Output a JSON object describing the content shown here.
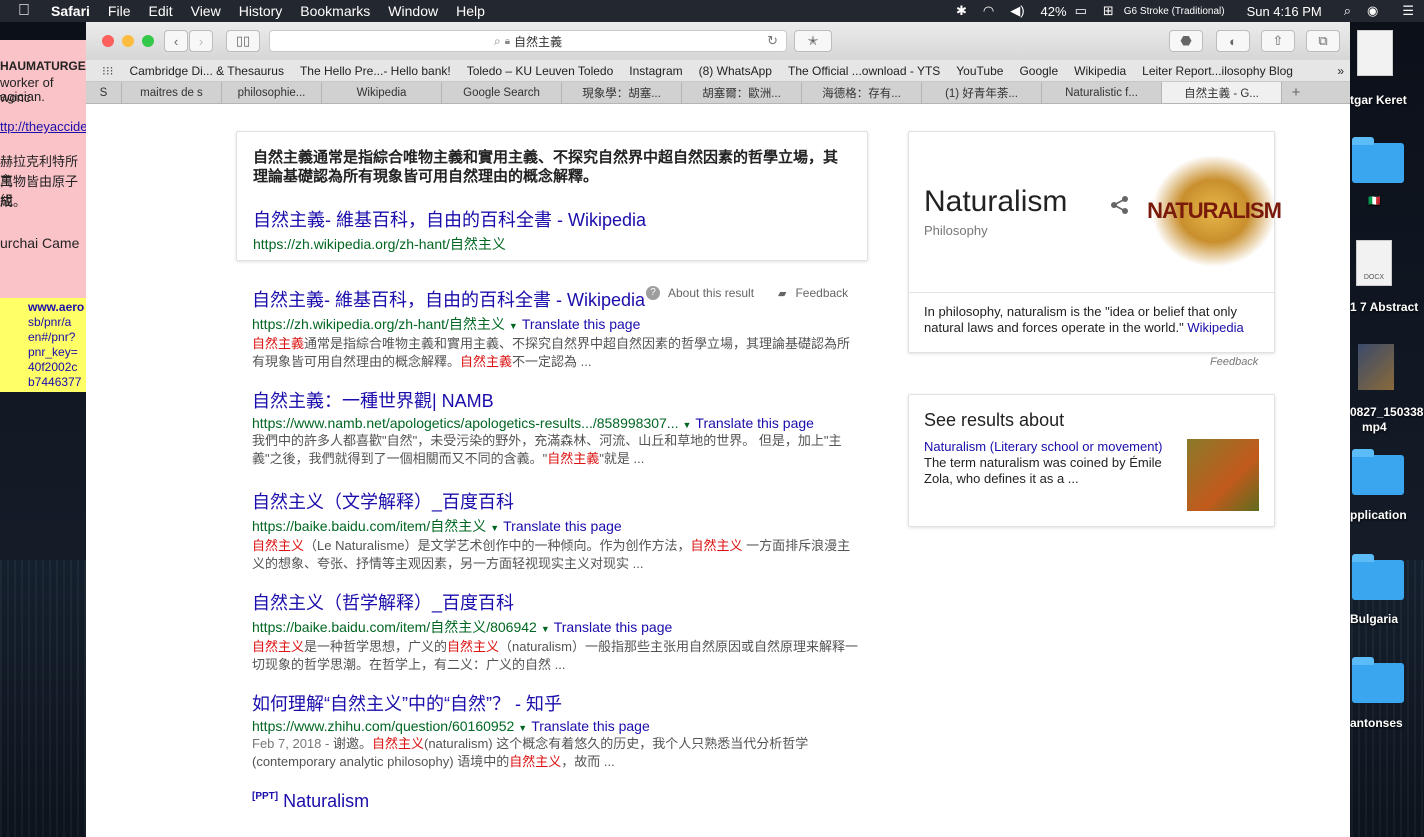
{
  "menubar": {
    "app": "Safari",
    "items": [
      "File",
      "Edit",
      "View",
      "History",
      "Bookmarks",
      "Window",
      "Help"
    ],
    "battery": "42%",
    "input_method": "G6 Stroke (Traditional)",
    "clock": "Sun 4:16 PM"
  },
  "desktop": {
    "labels": [
      "tgar Keret",
      "1 7 Abstract",
      "0827_150338",
      "mp4",
      "pplication",
      "Bulgaria",
      "antonses"
    ],
    "doc_label": "DOCX"
  },
  "sticky": {
    "pink_lines": [
      "HAUMATURGE",
      "worker of wonc",
      "agician.",
      "ttp://theyaccider",
      "赫拉克利特所主",
      "萬物皆由原子組",
      "成。",
      "urchai Came"
    ],
    "yellow_lines": [
      "www.aero",
      "sb/pnr/a",
      "en#/pnr?",
      "pnr_key=",
      "40f2002c",
      "b7446377"
    ]
  },
  "browser": {
    "address": "自然主義",
    "favorites": [
      "Cambridge Di... & Thesaurus",
      "The Hello Pre...- Hello bank!",
      "Toledo – KU Leuven Toledo",
      "Instagram",
      "(8) WhatsApp",
      "The Official ...ownload - YTS",
      "YouTube",
      "Google",
      "Wikipedia",
      "Leiter Report...ilosophy Blog"
    ],
    "tabs": [
      "S",
      "maitres de s",
      "philosophie...",
      "Wikipedia",
      "Google Search",
      "現象學：胡塞...",
      "胡塞爾：歐洲...",
      "海德格：存有...",
      "(1) 好青年荼...",
      "Naturalistic f...",
      "自然主義 - G..."
    ],
    "active_tab_index": 10
  },
  "featured": {
    "text_parts": [
      {
        "t": "自然主義",
        "b": true
      },
      {
        "t": "通常是指綜合唯物主義和實用主義、不探究自然界中超自然因素的哲學立場，其理論基礎認為所有現象皆可用自然理由的概念解釋。",
        "b": false
      }
    ],
    "title": "自然主義- 維基百科，自由的百科全書 - Wikipedia",
    "url": "https://zh.wikipedia.org/zh-hant/自然主义",
    "about": "About this result",
    "feedback": "Feedback"
  },
  "results": [
    {
      "title": "自然主義- 維基百科，自由的百科全書 - Wikipedia",
      "url": "https://zh.wikipedia.org/zh-hant/自然主义",
      "translate": "Translate this page",
      "snippet": [
        {
          "t": "自然主義",
          "hl": true
        },
        {
          "t": "通常是指綜合唯物主義和實用主義、不探究自然界中超自然因素的哲學立場，其理論基礎認為所有現象皆可用自然理由的概念解釋。",
          "hl": false
        },
        {
          "t": "自然主義",
          "hl": true
        },
        {
          "t": "不一定認為 ...",
          "hl": false
        }
      ]
    },
    {
      "title": "自然主義：一種世界觀| NAMB",
      "url": "https://www.namb.net/apologetics/apologetics-results.../858998307...",
      "translate": "Translate this page",
      "snippet": [
        {
          "t": "我們中的許多人都喜歡\"自然\"，未受污染的野外，充滿森林、河流、山丘和草地的世界。 但是，加上\"主義\"之後，我們就得到了一個相關而又不同的含義。\"",
          "hl": false
        },
        {
          "t": "自然主義",
          "hl": true
        },
        {
          "t": "\"就是 ...",
          "hl": false
        }
      ]
    },
    {
      "title": "自然主义（文学解释）_百度百科",
      "url": "https://baike.baidu.com/item/自然主义",
      "translate": "Translate this page",
      "snippet": [
        {
          "t": "自然主义",
          "hl": true
        },
        {
          "t": "（Le Naturalisme）是文学艺术创作中的一种倾向。作为创作方法，",
          "hl": false
        },
        {
          "t": "自然主义",
          "hl": true
        },
        {
          "t": " 一方面排斥浪漫主义的想象、夸张、抒情等主观因素，另一方面轻视现实主义对现实 ...",
          "hl": false
        }
      ]
    },
    {
      "title": "自然主义（哲学解释）_百度百科",
      "url": "https://baike.baidu.com/item/自然主义/806942",
      "translate": "Translate this page",
      "snippet": [
        {
          "t": "自然主义",
          "hl": true
        },
        {
          "t": "是一种哲学思想，广义的",
          "hl": false
        },
        {
          "t": "自然主义",
          "hl": true
        },
        {
          "t": "（naturalism）一般指那些主张用自然原因或自然原理来解释一切现象的哲学思潮。在哲学上，有二义：广义的自然 ...",
          "hl": false
        }
      ]
    },
    {
      "title": "如何理解“自然主义”中的“自然”？ - 知乎",
      "url": "https://www.zhihu.com/question/60160952",
      "translate": "Translate this page",
      "snippet": [
        {
          "t": "Feb 7, 2018 - ",
          "hl": false,
          "date": true
        },
        {
          "t": "谢邀。",
          "hl": false
        },
        {
          "t": "自然主义",
          "hl": true
        },
        {
          "t": "(naturalism) 这个概念有着悠久的历史，我个人只熟悉当代分析哲学(contemporary analytic philosophy) 语境中的",
          "hl": false
        },
        {
          "t": "自然主义",
          "hl": true
        },
        {
          "t": "，故而 ...",
          "hl": false
        }
      ]
    },
    {
      "title_tag": "[PPT]",
      "title": "Naturalism",
      "url": "",
      "translate": "",
      "snippet": []
    }
  ],
  "knowledge_panel": {
    "title": "Naturalism",
    "subtitle": "Philosophy",
    "image_word": "NATURALISM",
    "description": "In philosophy, naturalism is the \"idea or belief that only natural laws and forces operate in the world.\"",
    "source": "Wikipedia",
    "feedback": "Feedback"
  },
  "see_results": {
    "title": "See results about",
    "link": "Naturalism (Literary school or movement)",
    "desc": "The term naturalism was coined by Émile Zola, who defines it as a ..."
  }
}
